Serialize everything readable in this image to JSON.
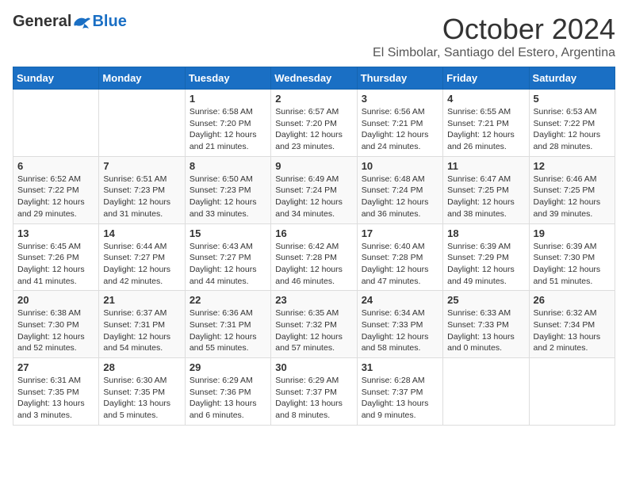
{
  "header": {
    "logo_general": "General",
    "logo_blue": "Blue",
    "month_title": "October 2024",
    "subtitle": "El Simbolar, Santiago del Estero, Argentina"
  },
  "weekdays": [
    "Sunday",
    "Monday",
    "Tuesday",
    "Wednesday",
    "Thursday",
    "Friday",
    "Saturday"
  ],
  "weeks": [
    [
      {
        "day": "",
        "info": ""
      },
      {
        "day": "",
        "info": ""
      },
      {
        "day": "1",
        "info": "Sunrise: 6:58 AM\nSunset: 7:20 PM\nDaylight: 12 hours and 21 minutes."
      },
      {
        "day": "2",
        "info": "Sunrise: 6:57 AM\nSunset: 7:20 PM\nDaylight: 12 hours and 23 minutes."
      },
      {
        "day": "3",
        "info": "Sunrise: 6:56 AM\nSunset: 7:21 PM\nDaylight: 12 hours and 24 minutes."
      },
      {
        "day": "4",
        "info": "Sunrise: 6:55 AM\nSunset: 7:21 PM\nDaylight: 12 hours and 26 minutes."
      },
      {
        "day": "5",
        "info": "Sunrise: 6:53 AM\nSunset: 7:22 PM\nDaylight: 12 hours and 28 minutes."
      }
    ],
    [
      {
        "day": "6",
        "info": "Sunrise: 6:52 AM\nSunset: 7:22 PM\nDaylight: 12 hours and 29 minutes."
      },
      {
        "day": "7",
        "info": "Sunrise: 6:51 AM\nSunset: 7:23 PM\nDaylight: 12 hours and 31 minutes."
      },
      {
        "day": "8",
        "info": "Sunrise: 6:50 AM\nSunset: 7:23 PM\nDaylight: 12 hours and 33 minutes."
      },
      {
        "day": "9",
        "info": "Sunrise: 6:49 AM\nSunset: 7:24 PM\nDaylight: 12 hours and 34 minutes."
      },
      {
        "day": "10",
        "info": "Sunrise: 6:48 AM\nSunset: 7:24 PM\nDaylight: 12 hours and 36 minutes."
      },
      {
        "day": "11",
        "info": "Sunrise: 6:47 AM\nSunset: 7:25 PM\nDaylight: 12 hours and 38 minutes."
      },
      {
        "day": "12",
        "info": "Sunrise: 6:46 AM\nSunset: 7:25 PM\nDaylight: 12 hours and 39 minutes."
      }
    ],
    [
      {
        "day": "13",
        "info": "Sunrise: 6:45 AM\nSunset: 7:26 PM\nDaylight: 12 hours and 41 minutes."
      },
      {
        "day": "14",
        "info": "Sunrise: 6:44 AM\nSunset: 7:27 PM\nDaylight: 12 hours and 42 minutes."
      },
      {
        "day": "15",
        "info": "Sunrise: 6:43 AM\nSunset: 7:27 PM\nDaylight: 12 hours and 44 minutes."
      },
      {
        "day": "16",
        "info": "Sunrise: 6:42 AM\nSunset: 7:28 PM\nDaylight: 12 hours and 46 minutes."
      },
      {
        "day": "17",
        "info": "Sunrise: 6:40 AM\nSunset: 7:28 PM\nDaylight: 12 hours and 47 minutes."
      },
      {
        "day": "18",
        "info": "Sunrise: 6:39 AM\nSunset: 7:29 PM\nDaylight: 12 hours and 49 minutes."
      },
      {
        "day": "19",
        "info": "Sunrise: 6:39 AM\nSunset: 7:30 PM\nDaylight: 12 hours and 51 minutes."
      }
    ],
    [
      {
        "day": "20",
        "info": "Sunrise: 6:38 AM\nSunset: 7:30 PM\nDaylight: 12 hours and 52 minutes."
      },
      {
        "day": "21",
        "info": "Sunrise: 6:37 AM\nSunset: 7:31 PM\nDaylight: 12 hours and 54 minutes."
      },
      {
        "day": "22",
        "info": "Sunrise: 6:36 AM\nSunset: 7:31 PM\nDaylight: 12 hours and 55 minutes."
      },
      {
        "day": "23",
        "info": "Sunrise: 6:35 AM\nSunset: 7:32 PM\nDaylight: 12 hours and 57 minutes."
      },
      {
        "day": "24",
        "info": "Sunrise: 6:34 AM\nSunset: 7:33 PM\nDaylight: 12 hours and 58 minutes."
      },
      {
        "day": "25",
        "info": "Sunrise: 6:33 AM\nSunset: 7:33 PM\nDaylight: 13 hours and 0 minutes."
      },
      {
        "day": "26",
        "info": "Sunrise: 6:32 AM\nSunset: 7:34 PM\nDaylight: 13 hours and 2 minutes."
      }
    ],
    [
      {
        "day": "27",
        "info": "Sunrise: 6:31 AM\nSunset: 7:35 PM\nDaylight: 13 hours and 3 minutes."
      },
      {
        "day": "28",
        "info": "Sunrise: 6:30 AM\nSunset: 7:35 PM\nDaylight: 13 hours and 5 minutes."
      },
      {
        "day": "29",
        "info": "Sunrise: 6:29 AM\nSunset: 7:36 PM\nDaylight: 13 hours and 6 minutes."
      },
      {
        "day": "30",
        "info": "Sunrise: 6:29 AM\nSunset: 7:37 PM\nDaylight: 13 hours and 8 minutes."
      },
      {
        "day": "31",
        "info": "Sunrise: 6:28 AM\nSunset: 7:37 PM\nDaylight: 13 hours and 9 minutes."
      },
      {
        "day": "",
        "info": ""
      },
      {
        "day": "",
        "info": ""
      }
    ]
  ]
}
